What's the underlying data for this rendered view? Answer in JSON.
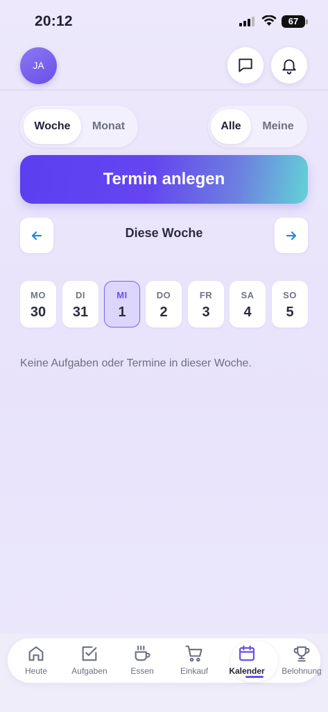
{
  "status": {
    "time": "20:12",
    "battery": "67"
  },
  "header": {
    "avatar_initials": "JA",
    "icons": [
      "message-icon",
      "bell-icon"
    ]
  },
  "view_toggle": {
    "week": "Woche",
    "month": "Monat",
    "active": "week"
  },
  "filter_toggle": {
    "all": "Alle",
    "mine": "Meine",
    "active": "all"
  },
  "create_button": "Termin anlegen",
  "week_nav": {
    "label": "Diese Woche",
    "prev_icon": "arrow-left-icon",
    "next_icon": "arrow-right-icon"
  },
  "days": [
    {
      "name": "MO",
      "date": "30"
    },
    {
      "name": "DI",
      "date": "31"
    },
    {
      "name": "MI",
      "date": "1"
    },
    {
      "name": "DO",
      "date": "2"
    },
    {
      "name": "FR",
      "date": "3"
    },
    {
      "name": "SA",
      "date": "4"
    },
    {
      "name": "SO",
      "date": "5"
    }
  ],
  "selected_day": "MI",
  "empty_message": "Keine Aufgaben oder Termine in dieser Woche.",
  "tabs": [
    {
      "label": "Heute",
      "icon": "home-icon"
    },
    {
      "label": "Aufgaben",
      "icon": "checkbox-icon"
    },
    {
      "label": "Essen",
      "icon": "cup-icon"
    },
    {
      "label": "Einkauf",
      "icon": "cart-icon"
    },
    {
      "label": "Kalender",
      "icon": "calendar-icon"
    },
    {
      "label": "Belohnung",
      "icon": "trophy-icon"
    }
  ],
  "active_tab": "Kalender",
  "colors": {
    "accent": "#6a4fe6",
    "gradient_start": "#5b3ff0",
    "gradient_end": "#62d3d6",
    "nav_arrow": "#1e88e5"
  }
}
